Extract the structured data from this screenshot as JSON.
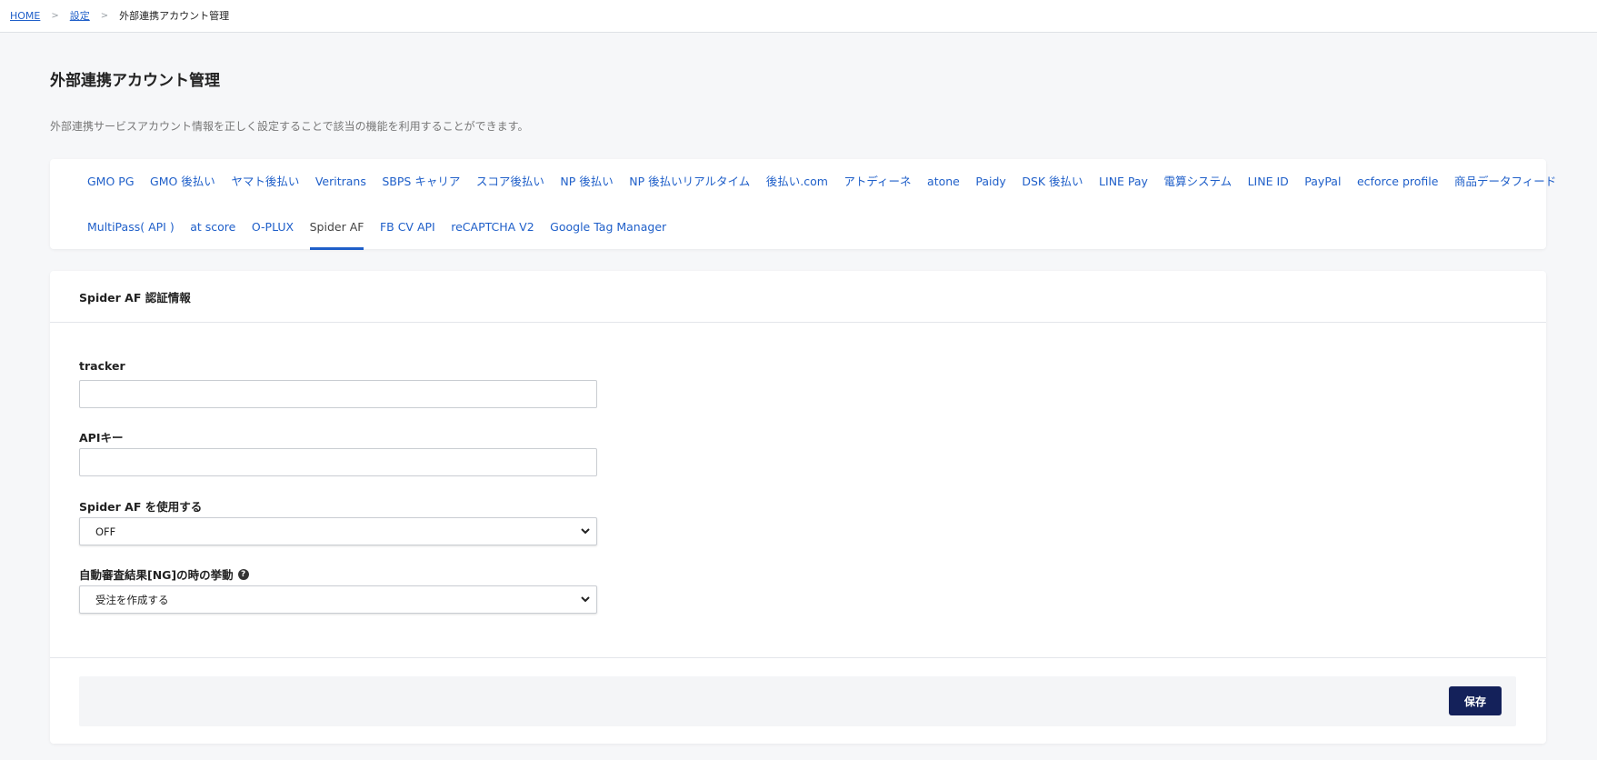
{
  "breadcrumb": {
    "home": "HOME",
    "settings": "設定",
    "current": "外部連携アカウント管理",
    "separator": ">"
  },
  "page": {
    "title": "外部連携アカウント管理",
    "description": "外部連携サービスアカウント情報を正しく設定することで該当の機能を利用することができます。"
  },
  "tabs": {
    "row1": [
      "GMO PG",
      "GMO 後払い",
      "ヤマト後払い",
      "Veritrans",
      "SBPS キャリア",
      "スコア後払い",
      "NP 後払い",
      "NP 後払いリアルタイム",
      "後払い.com",
      "アトディーネ",
      "atone",
      "Paidy",
      "DSK 後払い",
      "LINE Pay",
      "電算システム",
      "LINE ID",
      "PayPal",
      "ecforce profile",
      "商品データフィード"
    ],
    "row2": [
      "MultiPass( API )",
      "at score",
      "O-PLUX",
      "Spider AF",
      "FB CV API",
      "reCAPTCHA V2",
      "Google Tag Manager"
    ],
    "active": "Spider AF"
  },
  "form": {
    "header": "Spider AF 認証情報",
    "tracker_label": "tracker",
    "tracker_value": "",
    "api_key_label": "APIキー",
    "api_key_value": "",
    "use_label": "Spider AF を使用する",
    "use_value": "OFF",
    "ng_label": "自動審査結果[NG]の時の挙動",
    "ng_value": "受注を作成する",
    "help_icon": "question-circle-icon"
  },
  "footer": {
    "save_label": "保存"
  },
  "colors": {
    "link": "#1f5fc9",
    "save_button": "#14215a",
    "background": "#f6f7f9"
  }
}
